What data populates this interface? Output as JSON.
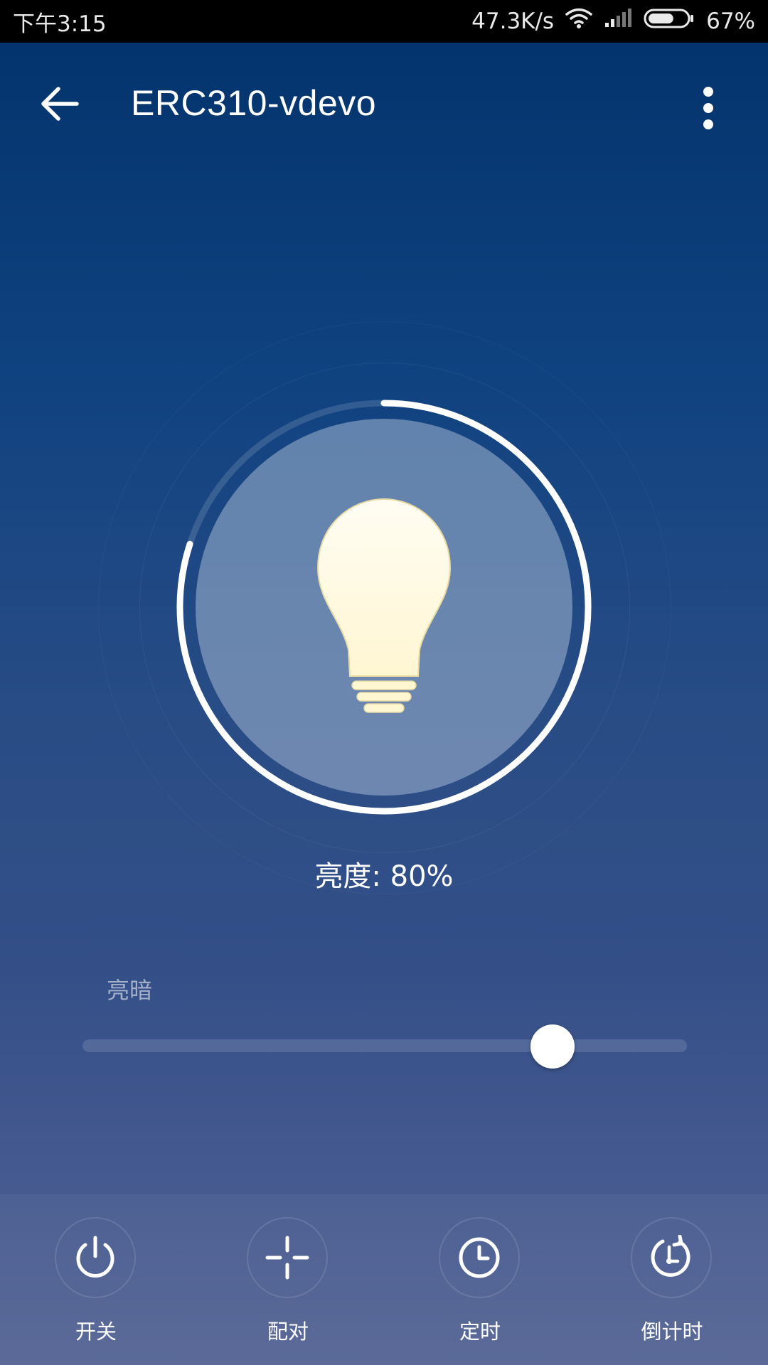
{
  "status_bar": {
    "time": "下午3:15",
    "network_speed": "47.3K/s",
    "battery": "67%",
    "battery_level": 0.67,
    "icons": [
      "wifi-icon",
      "signal-icon",
      "battery-icon"
    ]
  },
  "header": {
    "title": "ERC310-vdevo",
    "back_icon": "arrow-left-icon",
    "more_icon": "more-vertical-icon"
  },
  "lamp": {
    "icon": "light-bulb-icon",
    "brightness_text": "亮度: 80%",
    "brightness": 0.8
  },
  "slider": {
    "label": "亮暗",
    "value": 0.8
  },
  "actions": [
    {
      "label": "开关",
      "icon": "power-icon"
    },
    {
      "label": "配对",
      "icon": "pair-crosshair-icon"
    },
    {
      "label": "定时",
      "icon": "clock-icon"
    },
    {
      "label": "倒计时",
      "icon": "countdown-icon"
    }
  ],
  "colors": {
    "background_top": "#04346d",
    "background_bottom": "#556494",
    "bulb": "#fffbe4",
    "progress_ring": "#ffffff"
  }
}
